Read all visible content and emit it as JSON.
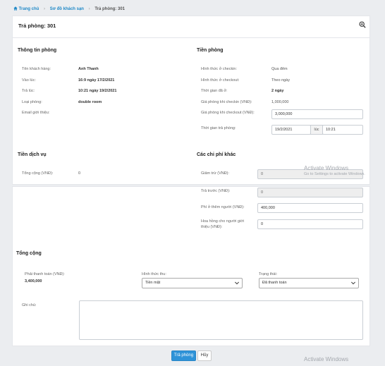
{
  "breadcrumb": {
    "home": "Trang chủ",
    "map": "Sơ đồ khách sạn",
    "current": "Trả phòng: 301"
  },
  "page": {
    "title": "Trả phòng: 301"
  },
  "room_info": {
    "heading": "Thông tin phòng",
    "customer_label": "Tên khách hàng:",
    "customer_value": "Anh Thanh",
    "checkin_label": "Vào lúc:",
    "checkin_value": "16:9 ngày 17/2/2021",
    "checkout_label": "Trả lúc:",
    "checkout_value": "10:21 ngày 19/2/2021",
    "room_type_label": "Loại phòng:",
    "room_type_value": "double room",
    "email_label": "Email giới thiệu:"
  },
  "room_fee": {
    "heading": "Tiền phòng",
    "checkin_mode_label": "Hình thức ở checkin:",
    "checkin_mode_value": "Qua đêm",
    "checkout_mode_label": "Hình thức ở checkout:",
    "checkout_mode_value": "Theo ngày",
    "stay_label": "Thời gian đã ở:",
    "stay_value": "2 ngày",
    "checkin_price_label": "Giá phòng khi checkin (VNĐ):",
    "checkin_price_value": "1,000,000",
    "checkout_price_label": "Giá phòng khi checkout (VNĐ):",
    "checkout_price_value": "3,000,000",
    "return_time_label": "Thời gian trả phòng:",
    "return_date_value": "19/2/2021",
    "at_label": "lúc",
    "return_hour_value": "10:21"
  },
  "services": {
    "heading": "Tiền dịch vụ",
    "total_label": "Tổng cộng (VNĐ):",
    "total_value": "0"
  },
  "other_fees": {
    "heading": "Các chi phí khác",
    "discount_label": "Giảm trừ (VNĐ):",
    "discount_value": "0",
    "prepaid_label": "Trả trước (VNĐ):",
    "prepaid_value": "0",
    "extra_person_label": "Phí ở thêm người (VNĐ):",
    "extra_person_value": "400,000",
    "commission_label_1": "Hoa hồng cho người giới",
    "commission_label_2": "thiệu (VNĐ):",
    "commission_value": "0"
  },
  "summary": {
    "heading": "Tổng cộng",
    "payable_label": "Phải thanh toán (VNĐ):",
    "payable_value": "3,400,000",
    "method_label": "Hình thức thu:",
    "method_value": "Tiền mặt",
    "status_label": "Trạng thái:",
    "status_value": "Đã thanh toán",
    "note_label": "Ghi chú:",
    "note_value": ""
  },
  "actions": {
    "checkout": "Trả phòng",
    "cancel": "Hủy"
  },
  "watermark": {
    "title": "Activate Windows",
    "subtitle": "Go to Settings to activate Windows."
  },
  "colors": {
    "link": "#1e88c7",
    "primary_button": "#2e93d8",
    "page_background": "#ebedf0"
  },
  "icons": {
    "home": "home-icon",
    "zoom": "zoom-in-icon",
    "select_arrow": "chevron-down-icon"
  }
}
